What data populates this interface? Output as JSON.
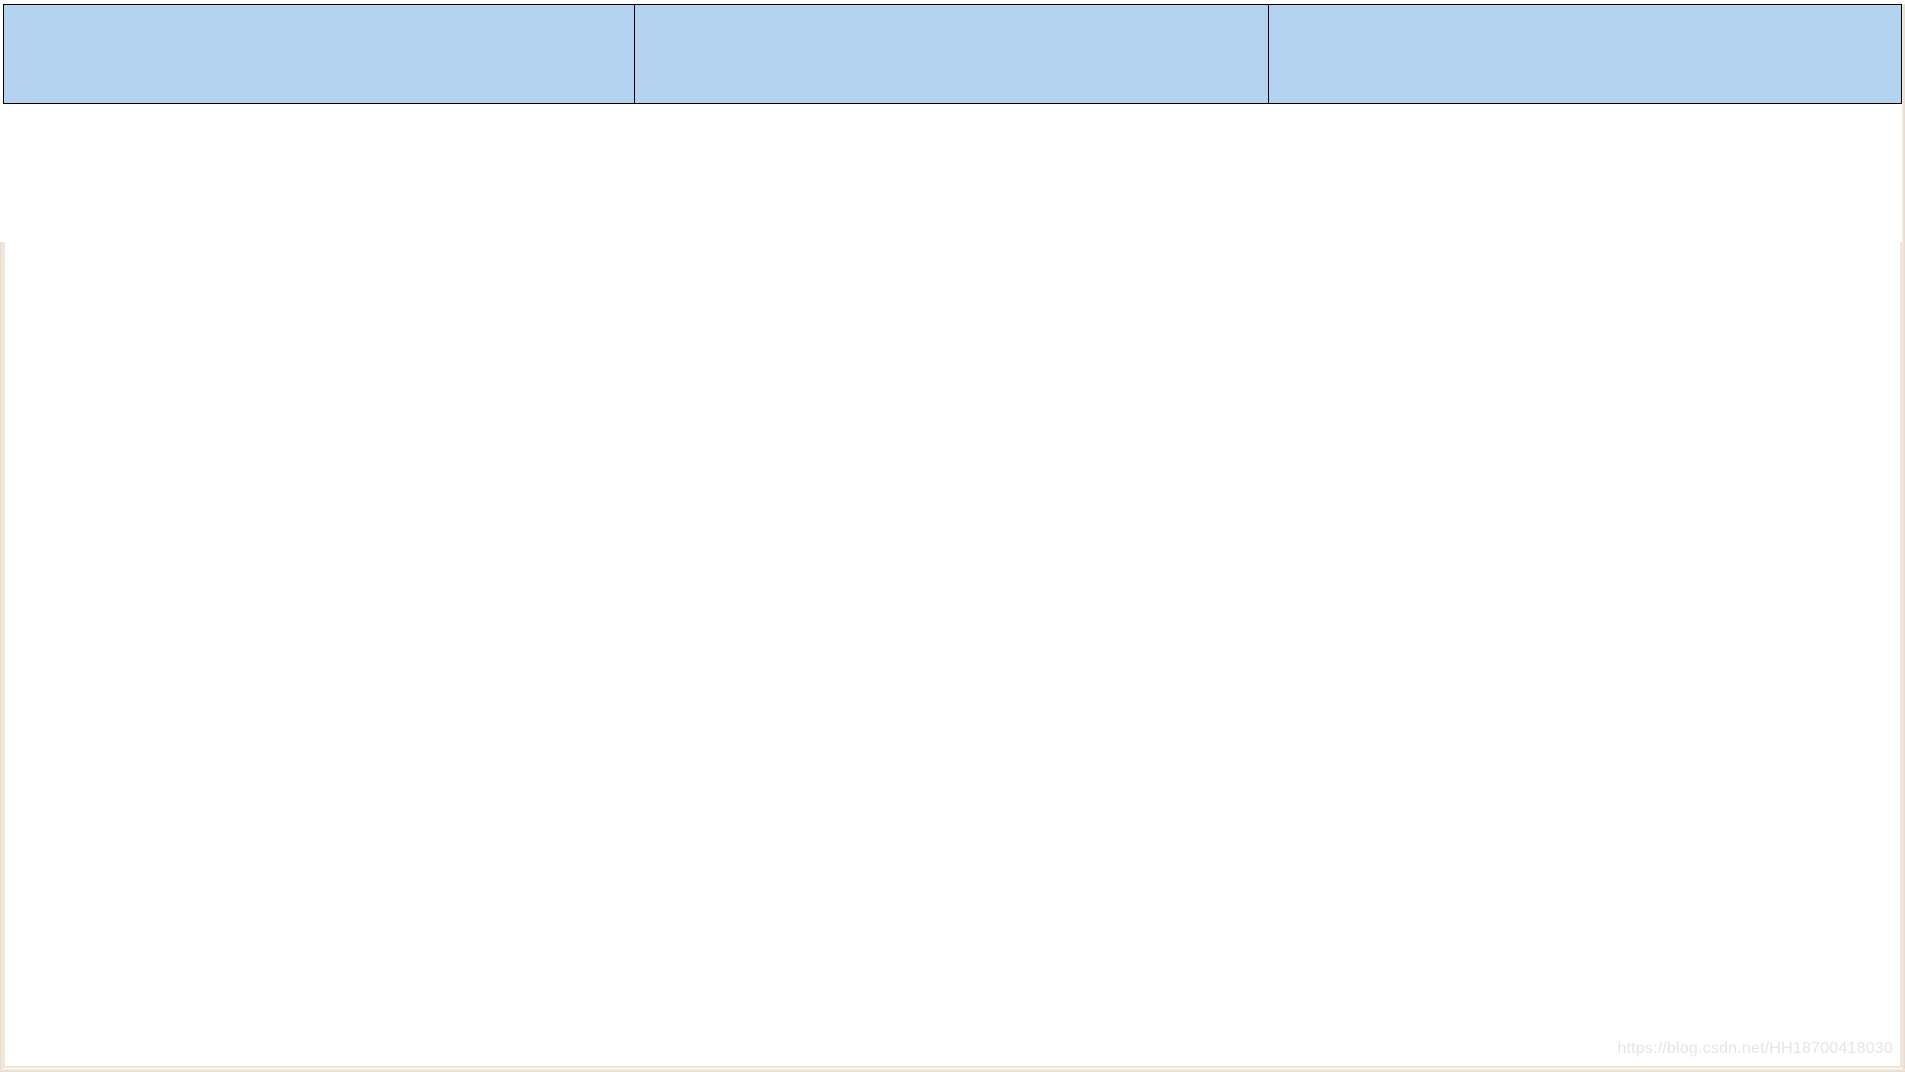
{
  "table": {
    "header_cells": [
      "",
      "",
      ""
    ],
    "header_bg_color": "#b4d3f0",
    "border_color": "#000000"
  },
  "watermark": {
    "text": "https://blog.csdn.net/HH18700418030"
  }
}
